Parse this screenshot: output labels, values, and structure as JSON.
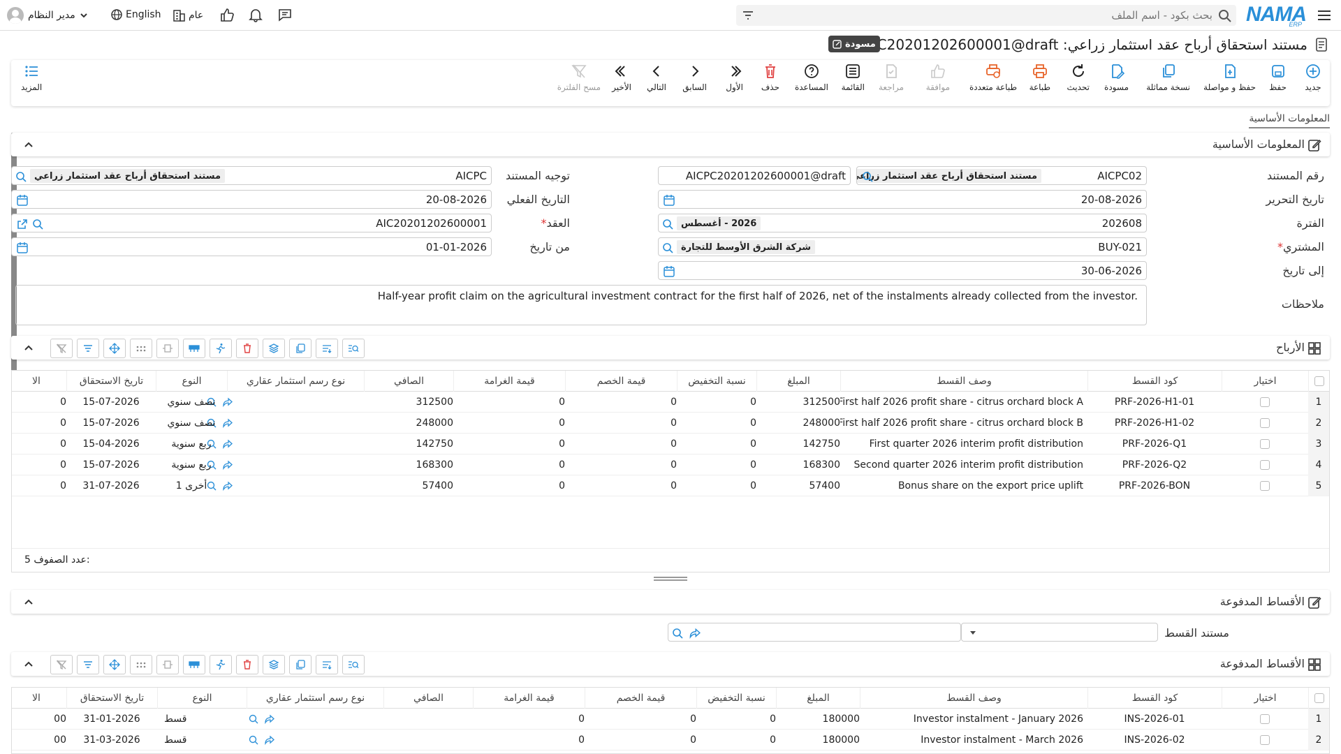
{
  "topbar": {
    "brand": "NAMA",
    "brand_sub": "ERP",
    "search_placeholder": "بحث بكود - اسم الملف",
    "user_name": "مدير النظام",
    "language": "English",
    "scope": "عام"
  },
  "document": {
    "title": "مستند استحقاق أرباح عقد استثمار زراعي: AICPC20201202600001@draft",
    "status_badge": "مسودة"
  },
  "toolbar": {
    "items": [
      {
        "label": "جديد",
        "icon": "plus-circle-icon",
        "enabled": true
      },
      {
        "label": "حفظ",
        "icon": "save-icon",
        "enabled": true
      },
      {
        "label": "حفظ و مواصلة",
        "icon": "save-continue-icon",
        "enabled": true
      },
      {
        "label": "نسخة مماثلة",
        "icon": "copy-icon",
        "enabled": true
      },
      {
        "label": "مسودة",
        "icon": "edit-icon",
        "enabled": true
      },
      {
        "label": "تحديث",
        "icon": "refresh-icon",
        "enabled": true
      },
      {
        "label": "طباعة",
        "icon": "print-icon",
        "enabled": true
      },
      {
        "label": "طباعة متعددة",
        "icon": "multi-print-icon",
        "enabled": true
      },
      {
        "label": "موافقة",
        "icon": "thumbs-up-icon",
        "enabled": false
      },
      {
        "label": "مراجعة",
        "icon": "review-icon",
        "enabled": false
      },
      {
        "label": "القائمة",
        "icon": "list-icon",
        "enabled": true
      },
      {
        "label": "المساعدة",
        "icon": "help-icon",
        "enabled": true
      },
      {
        "label": "حذف",
        "icon": "trash-icon",
        "enabled": true
      },
      {
        "label": "الأول",
        "icon": "first-icon",
        "enabled": true
      },
      {
        "label": "السابق",
        "icon": "prev-icon",
        "enabled": true
      },
      {
        "label": "التالي",
        "icon": "next-icon",
        "enabled": true
      },
      {
        "label": "الأخير",
        "icon": "last-icon",
        "enabled": true
      },
      {
        "label": "مسح الفلترة",
        "icon": "clear-filter-icon",
        "enabled": false
      }
    ],
    "more_label": "المزيد"
  },
  "tabs": {
    "basic_info": "المعلومات الأساسية"
  },
  "sections": {
    "basic_info": "المعلومات الأساسية",
    "profits": "الأرباح",
    "paid_installments": "الأقساط المدفوعة",
    "paid_installments_grid": "الأقساط المدفوعة"
  },
  "form": {
    "doc_number_label": "رقم المستند",
    "doc_number_code": "AICPC02",
    "doc_number_name": "مستند استحقاق أرباح عقد استثمار زراعي",
    "doc_number_value": "AICPC20201202600001@draft",
    "doc_direction_label": "توجيه المستند",
    "doc_direction_code": "AICPC",
    "doc_direction_name": "مستند استحقاق أرباح عقد استثمار زراعي",
    "edit_date_label": "تاريخ التحرير",
    "edit_date": "20-08-2026",
    "actual_date_label": "التاريخ الفعلي",
    "actual_date": "20-08-2026",
    "period_label": "الفترة",
    "period_code": "202608",
    "period_name": "2026 - أغسطس",
    "contract_label": "العقد",
    "contract_value": "AIC20201202600001",
    "buyer_label": "المشتري",
    "buyer_code": "BUY-021",
    "buyer_name": "شركة الشرق الأوسط للتجارة",
    "from_date_label": "من تاريخ",
    "from_date": "01-01-2026",
    "to_date_label": "إلى تاريخ",
    "to_date": "30-06-2026",
    "notes_label": "ملاحظات",
    "notes": "Half-year profit claim on the agricultural investment contract for the first half of 2026, net of the instalments already collected from the investor."
  },
  "grid_columns": {
    "select": "اختيار",
    "code": "كود القسط",
    "desc": "وصف القسط",
    "amount": "المبلغ",
    "discount_pct": "نسبة التخفيض",
    "discount_val": "قيمة الخصم",
    "penalty": "قيمة الغرامة",
    "net": "الصافي",
    "fee_type": "نوع رسم استثمار عقاري",
    "type": "النوع",
    "due_date": "تاريخ الاستحقاق",
    "extra": "الا"
  },
  "profits_grid": {
    "rows": [
      {
        "n": "1",
        "code": "PRF-2026-H1-01",
        "desc": "First half 2026 profit share - citrus orchard block A",
        "amount": "312500",
        "dpct": "0",
        "dval": "0",
        "pen": "0",
        "net": "312500",
        "type": "نصف سنوي",
        "due": "15-07-2026",
        "extra": "0"
      },
      {
        "n": "2",
        "code": "PRF-2026-H1-02",
        "desc": "First half 2026 profit share - citrus orchard block B",
        "amount": "248000",
        "dpct": "0",
        "dval": "0",
        "pen": "0",
        "net": "248000",
        "type": "نصف سنوي",
        "due": "15-07-2026",
        "extra": "0"
      },
      {
        "n": "3",
        "code": "PRF-2026-Q1",
        "desc": "First quarter 2026 interim profit distribution",
        "amount": "142750",
        "dpct": "0",
        "dval": "0",
        "pen": "0",
        "net": "142750",
        "type": "ربع سنوية",
        "due": "15-04-2026",
        "extra": "0"
      },
      {
        "n": "4",
        "code": "PRF-2026-Q2",
        "desc": "Second quarter 2026 interim profit distribution",
        "amount": "168300",
        "dpct": "0",
        "dval": "0",
        "pen": "0",
        "net": "168300",
        "type": "ربع سنوية",
        "due": "15-07-2026",
        "extra": "0"
      },
      {
        "n": "5",
        "code": "PRF-2026-BON",
        "desc": "Bonus share on the export price uplift",
        "amount": "57400",
        "dpct": "0",
        "dval": "0",
        "pen": "0",
        "net": "57400",
        "type": "أخرى 1",
        "due": "31-07-2026",
        "extra": "0"
      }
    ],
    "row_count_label": "عدد الصفوف:",
    "row_count": "5"
  },
  "installment_doc": {
    "label": "مستند القسط"
  },
  "paid_grid": {
    "rows": [
      {
        "n": "1",
        "code": "INS-2026-01",
        "desc": "Investor instalment - January 2026",
        "amount": "180000",
        "dpct": "0",
        "dval": "0",
        "pen": "0",
        "net": "",
        "type": "قسط",
        "due": "31-01-2026",
        "extra": "00"
      },
      {
        "n": "2",
        "code": "INS-2026-02",
        "desc": "Investor instalment - March 2026",
        "amount": "180000",
        "dpct": "0",
        "dval": "0",
        "pen": "0",
        "net": "",
        "type": "قسط",
        "due": "31-03-2026",
        "extra": "00"
      }
    ]
  },
  "colors": {
    "accent": "#2a8fd8",
    "delete": "#e04040",
    "print": "#e8642a",
    "badge": "#444444"
  }
}
